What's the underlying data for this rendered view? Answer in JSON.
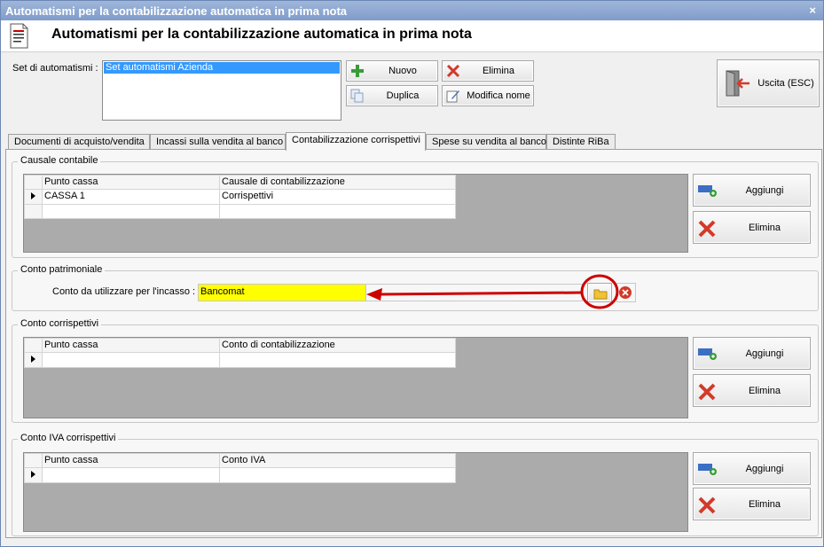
{
  "window": {
    "title": "Automatismi per la contabilizzazione automatica in prima nota",
    "close_glyph": "×"
  },
  "header": {
    "title": "Automatismi per la contabilizzazione automatica in prima nota",
    "icon": "document-icon"
  },
  "set": {
    "label": "Set di automatismi :",
    "items": [
      "Set automatismi Azienda"
    ]
  },
  "buttons": {
    "nuovo": "Nuovo",
    "elimina": "Elimina",
    "duplica": "Duplica",
    "modifica_nome": "Modifica nome",
    "uscita": "Uscita (ESC)"
  },
  "tabs": [
    "Documenti di acquisto/vendita",
    "Incassi sulla vendita al banco",
    "Contabilizzazione corrispettivi",
    "Spese su vendita al banco",
    "Distinte RiBa"
  ],
  "active_tab": "Contabilizzazione corrispettivi",
  "causale": {
    "title": "Causale contabile",
    "columns": [
      "Punto cassa",
      "Causale di contabilizzazione"
    ],
    "rows": [
      [
        "CASSA 1",
        "Corrispettivi"
      ]
    ],
    "add_label": "Aggiungi",
    "delete_label": "Elimina"
  },
  "conto_patrimoniale": {
    "title": "Conto patrimoniale",
    "label": "Conto da utilizzare per l'incasso :",
    "value": "Bancomat"
  },
  "conto_corrispettivi": {
    "title": "Conto corrispettivi",
    "columns": [
      "Punto cassa",
      "Conto di contabilizzazione"
    ],
    "add_label": "Aggiungi",
    "delete_label": "Elimina"
  },
  "conto_iva": {
    "title": "Conto IVA corrispettivi",
    "columns": [
      "Punto cassa",
      "Conto IVA"
    ],
    "add_label": "Aggiungi",
    "delete_label": "Elimina"
  },
  "colors": {
    "highlight": "#ffff00",
    "annotation": "#cc0000",
    "selection": "#3399ff"
  }
}
